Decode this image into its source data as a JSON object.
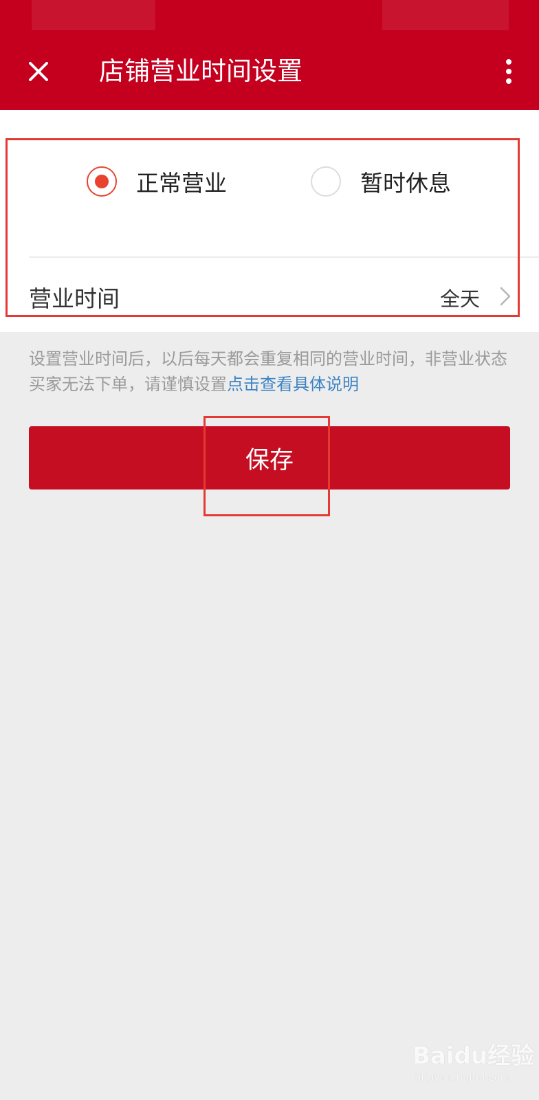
{
  "header": {
    "title": "店铺营业时间设置",
    "close_icon": "close-icon",
    "more_icon": "more-vertical-icon",
    "background_color": "#c4001e"
  },
  "status": {
    "options": [
      {
        "label": "正常营业",
        "selected": true
      },
      {
        "label": "暂时休息",
        "selected": false
      }
    ],
    "accent_color": "#e8432f"
  },
  "business_hours": {
    "label": "营业时间",
    "value": "全天",
    "chevron_icon": "chevron-right-icon"
  },
  "notice": {
    "text": "设置营业时间后，以后每天都会重复相同的营业时间，非营业状态买家无法下单，请谨慎设置",
    "link_text": "点击查看具体说明",
    "link_color": "#3b82c4"
  },
  "save_button": {
    "label": "保存",
    "color": "#c50e22"
  },
  "annotations": {
    "color": "#e53935"
  },
  "watermark": {
    "main": "Baidu经验",
    "sub": "jingyan.baidu.com"
  }
}
